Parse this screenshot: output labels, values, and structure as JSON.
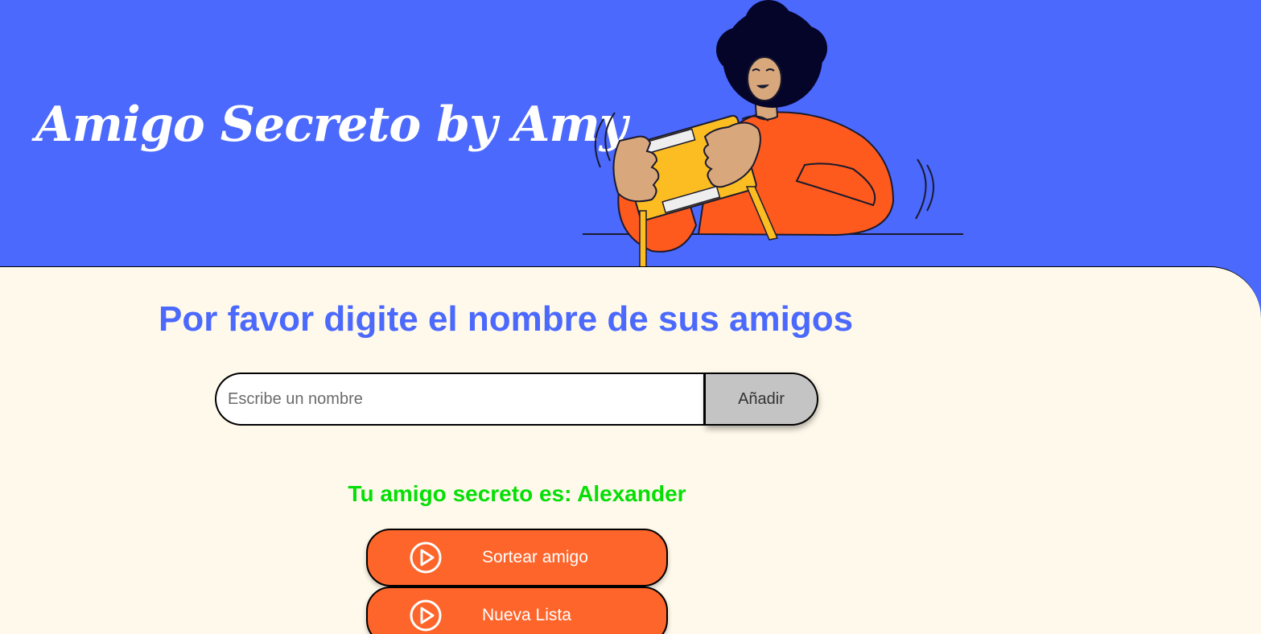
{
  "header": {
    "title": "Amigo Secreto by Amy",
    "illustration": "person-holding-gift-box-illustration"
  },
  "main": {
    "heading": "Por favor digite el nombre de sus amigos",
    "input": {
      "placeholder": "Escribe un nombre",
      "value": ""
    },
    "add_button_label": "Añadir",
    "result_text": "Tu amigo secreto es: Alexander",
    "buttons": [
      {
        "label": "Sortear amigo",
        "icon": "play-circle-icon"
      },
      {
        "label": "Nueva Lista",
        "icon": "play-circle-icon"
      }
    ]
  },
  "colors": {
    "header_bg": "#4b69fd",
    "content_bg": "#fff9eb",
    "heading": "#4b69fd",
    "result": "#05df05",
    "button_bg": "#fe652b",
    "add_button_bg": "#c4c4c4"
  }
}
